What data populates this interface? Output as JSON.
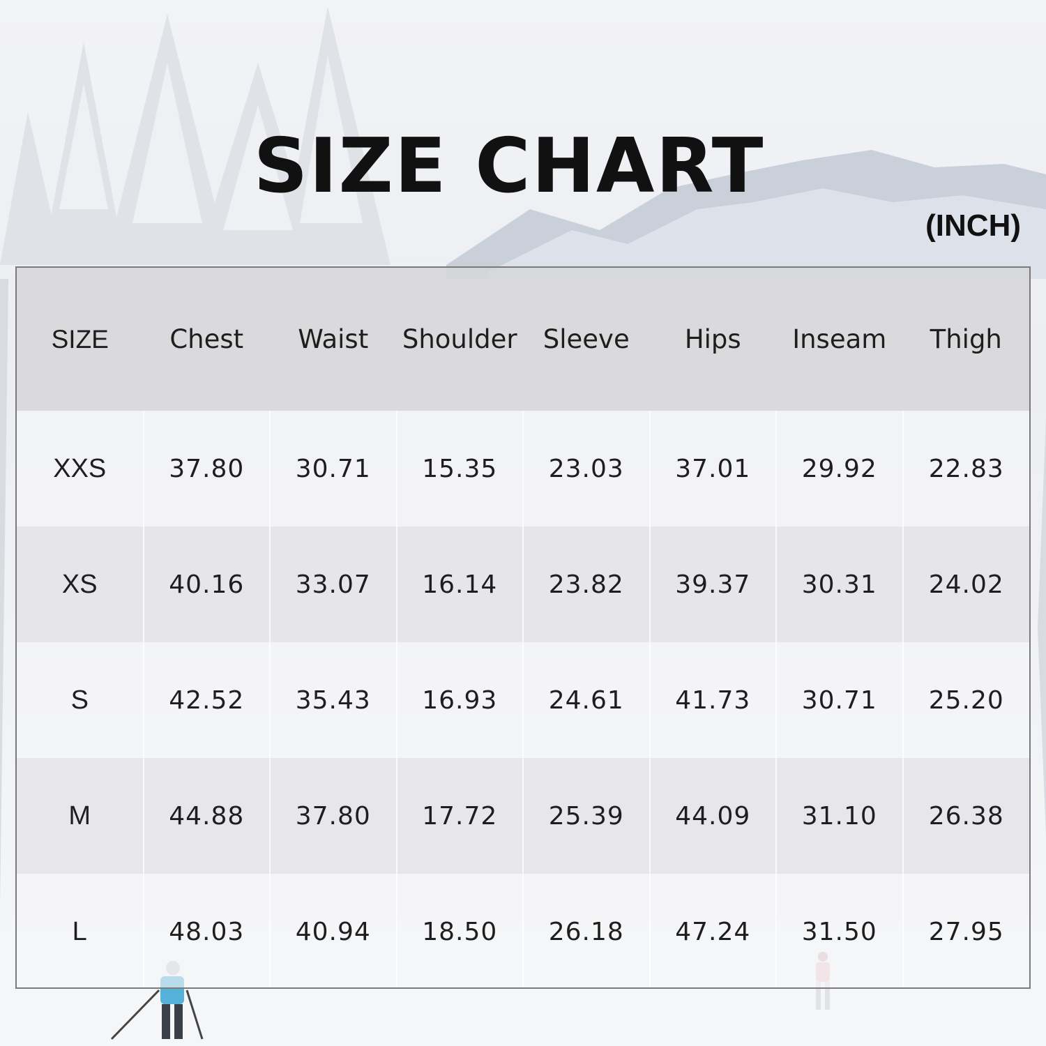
{
  "title": "SIZE CHART",
  "unit": "(INCH)",
  "chart_data": {
    "type": "table",
    "title": "SIZE CHART",
    "unit": "(INCH)",
    "columns": [
      "SIZE",
      "Chest",
      "Waist",
      "Shoulder",
      "Sleeve",
      "Hips",
      "Inseam",
      "Thigh"
    ],
    "rows": [
      [
        "XXS",
        "37.80",
        "30.71",
        "15.35",
        "23.03",
        "37.01",
        "29.92",
        "22.83"
      ],
      [
        "XS",
        "40.16",
        "33.07",
        "16.14",
        "23.82",
        "39.37",
        "30.31",
        "24.02"
      ],
      [
        "S",
        "42.52",
        "35.43",
        "16.93",
        "24.61",
        "41.73",
        "30.71",
        "25.20"
      ],
      [
        "M",
        "44.88",
        "37.80",
        "17.72",
        "25.39",
        "44.09",
        "31.10",
        "26.38"
      ],
      [
        "L",
        "48.03",
        "40.94",
        "18.50",
        "26.18",
        "47.24",
        "31.50",
        "27.95"
      ]
    ]
  }
}
